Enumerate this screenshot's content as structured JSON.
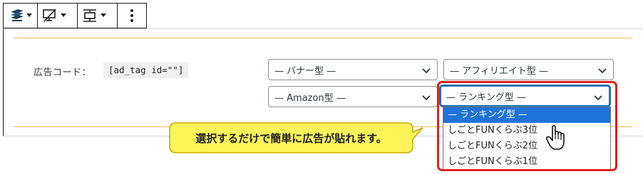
{
  "toolbar": {
    "buttons": [
      {
        "icon": "block-type-icon",
        "has_dropdown": true
      },
      {
        "icon": "device-visibility-icon",
        "has_dropdown": true
      },
      {
        "icon": "vertical-spacing-icon",
        "has_dropdown": true
      },
      {
        "icon": "more-options-icon",
        "has_dropdown": false
      }
    ]
  },
  "form": {
    "label": "広告コード：",
    "code_value": "[ad_tag id=\"\"]"
  },
  "selects": {
    "banner": "— バナー型 —",
    "affiliate": "— アフィリエイト型 —",
    "amazon": "— Amazon型 —",
    "ranking": "— ランキング型 —"
  },
  "dropdown": {
    "options": [
      "— ランキング型 —",
      "しごとFUNくらぶ3位",
      "しごとFUNくらぶ2位",
      "しごとFUNくらぶ1位"
    ],
    "selected_index": 0
  },
  "callout": {
    "text": "選択するだけで簡単に広告が貼れます。"
  },
  "colors": {
    "accent_orange": "#f6b85a",
    "focus_blue": "#2271b1",
    "selected_option": "#1e73d8",
    "highlight_red": "#e02020",
    "callout_fill": "#fff35a",
    "callout_border": "#c9a800"
  }
}
